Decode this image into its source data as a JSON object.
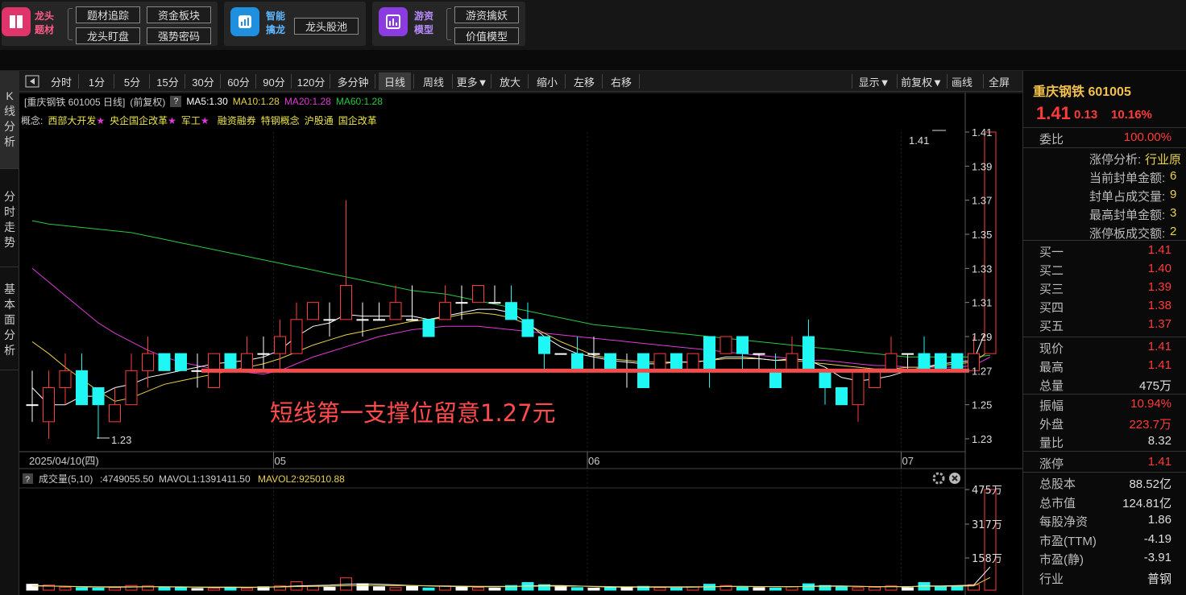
{
  "banner": {
    "groups": [
      {
        "title": "龙头\n题材",
        "buttons": [
          "题材追踪",
          "资金板块",
          "龙头盯盘",
          "强势密码"
        ]
      },
      {
        "title": "智能\n擒龙",
        "buttons": [
          "龙头股池"
        ]
      },
      {
        "title": "游资\n模型",
        "buttons": [
          "游资擒妖",
          "价值模型"
        ]
      }
    ]
  },
  "lefttabs": [
    "K\n线\n分\n析",
    "分\n时\n走\n势",
    "基\n本\n面\n分\n析"
  ],
  "toolbar": {
    "items": [
      "分时",
      "1分",
      "5分",
      "15分",
      "30分",
      "60分",
      "90分",
      "120分",
      "多分钟",
      "日线",
      "周线",
      "更多▼",
      "放大",
      "缩小",
      "左移",
      "右移"
    ],
    "active": "日线",
    "right_items": [
      "显示▼",
      "前复权▼",
      "画线",
      "全屏"
    ]
  },
  "chart": {
    "header": "[重庆钢铁 601005 日线]",
    "adjust": "(前复权)",
    "help": "?",
    "ma": [
      {
        "label": "MA5:1.30",
        "color": "#ffffff"
      },
      {
        "label": "MA10:1.28",
        "color": "#e8d34a"
      },
      {
        "label": "MA20:1.28",
        "color": "#e23ad8"
      },
      {
        "label": "MA60:1.28",
        "color": "#27c93f"
      }
    ],
    "concept_label": "概念:",
    "concepts": [
      "西部大开发",
      "央企国企改革",
      "军工",
      "融资融券",
      "特钢概念",
      "沪股通",
      "国企改革"
    ],
    "concept_star": "★",
    "annotation": "短线第一支撑位留意1.27元",
    "support_level": 1.27,
    "max_label": "1.41",
    "min_label": "1.23",
    "date_label": "2025/04/10(四)",
    "volume_header": "成交量(5,10)",
    "volume_value": ":4749055.50",
    "mavol1": "MAVOL1:1391411.50",
    "mavol2": "MAVOL2:925010.88"
  },
  "chart_data": {
    "type": "candlestick",
    "y_ticks": [
      "1.41",
      "1.39",
      "1.37",
      "1.35",
      "1.33",
      "1.31",
      "1.29",
      "1.27",
      "1.25",
      "1.23"
    ],
    "ylim": [
      1.222,
      1.412
    ],
    "x_ticks": [
      "05",
      "06",
      "07"
    ],
    "x_tick_index": [
      15,
      34,
      53
    ],
    "volume_ticks": [
      "475万",
      "317万",
      "158万"
    ],
    "volume_unit_max": 475,
    "candles": [
      {
        "o": 1.25,
        "c": 1.25,
        "h": 1.27,
        "l": 1.24
      },
      {
        "o": 1.24,
        "c": 1.26,
        "h": 1.27,
        "l": 1.23
      },
      {
        "o": 1.26,
        "c": 1.27,
        "h": 1.28,
        "l": 1.25
      },
      {
        "o": 1.27,
        "c": 1.25,
        "h": 1.28,
        "l": 1.25
      },
      {
        "o": 1.26,
        "c": 1.25,
        "h": 1.26,
        "l": 1.23
      },
      {
        "o": 1.24,
        "c": 1.25,
        "h": 1.26,
        "l": 1.24
      },
      {
        "o": 1.25,
        "c": 1.27,
        "h": 1.28,
        "l": 1.25
      },
      {
        "o": 1.27,
        "c": 1.28,
        "h": 1.29,
        "l": 1.26
      },
      {
        "o": 1.28,
        "c": 1.27,
        "h": 1.28,
        "l": 1.27
      },
      {
        "o": 1.28,
        "c": 1.27,
        "h": 1.28,
        "l": 1.27
      },
      {
        "o": 1.27,
        "c": 1.27,
        "h": 1.28,
        "l": 1.26
      },
      {
        "o": 1.26,
        "c": 1.28,
        "h": 1.28,
        "l": 1.26
      },
      {
        "o": 1.28,
        "c": 1.27,
        "h": 1.28,
        "l": 1.27
      },
      {
        "o": 1.27,
        "c": 1.28,
        "h": 1.29,
        "l": 1.27
      },
      {
        "o": 1.28,
        "c": 1.28,
        "h": 1.29,
        "l": 1.27
      },
      {
        "o": 1.28,
        "c": 1.29,
        "h": 1.3,
        "l": 1.27
      },
      {
        "o": 1.28,
        "c": 1.3,
        "h": 1.31,
        "l": 1.28
      },
      {
        "o": 1.3,
        "c": 1.31,
        "h": 1.31,
        "l": 1.3
      },
      {
        "o": 1.3,
        "c": 1.3,
        "h": 1.31,
        "l": 1.29
      },
      {
        "o": 1.3,
        "c": 1.32,
        "h": 1.37,
        "l": 1.3
      },
      {
        "o": 1.3,
        "c": 1.3,
        "h": 1.31,
        "l": 1.29
      },
      {
        "o": 1.3,
        "c": 1.3,
        "h": 1.31,
        "l": 1.3
      },
      {
        "o": 1.3,
        "c": 1.31,
        "h": 1.32,
        "l": 1.3
      },
      {
        "o": 1.3,
        "c": 1.3,
        "h": 1.32,
        "l": 1.3
      },
      {
        "o": 1.3,
        "c": 1.29,
        "h": 1.3,
        "l": 1.29
      },
      {
        "o": 1.3,
        "c": 1.31,
        "h": 1.32,
        "l": 1.3
      },
      {
        "o": 1.31,
        "c": 1.31,
        "h": 1.32,
        "l": 1.3
      },
      {
        "o": 1.31,
        "c": 1.32,
        "h": 1.32,
        "l": 1.31
      },
      {
        "o": 1.31,
        "c": 1.31,
        "h": 1.32,
        "l": 1.31
      },
      {
        "o": 1.31,
        "c": 1.3,
        "h": 1.32,
        "l": 1.3
      },
      {
        "o": 1.3,
        "c": 1.29,
        "h": 1.31,
        "l": 1.29
      },
      {
        "o": 1.29,
        "c": 1.28,
        "h": 1.29,
        "l": 1.27
      },
      {
        "o": 1.28,
        "c": 1.28,
        "h": 1.28,
        "l": 1.28
      },
      {
        "o": 1.28,
        "c": 1.27,
        "h": 1.29,
        "l": 1.27
      },
      {
        "o": 1.28,
        "c": 1.28,
        "h": 1.29,
        "l": 1.27
      },
      {
        "o": 1.28,
        "c": 1.27,
        "h": 1.28,
        "l": 1.27
      },
      {
        "o": 1.27,
        "c": 1.27,
        "h": 1.28,
        "l": 1.26
      },
      {
        "o": 1.28,
        "c": 1.26,
        "h": 1.28,
        "l": 1.26
      },
      {
        "o": 1.27,
        "c": 1.28,
        "h": 1.28,
        "l": 1.27
      },
      {
        "o": 1.28,
        "c": 1.27,
        "h": 1.28,
        "l": 1.27
      },
      {
        "o": 1.27,
        "c": 1.28,
        "h": 1.28,
        "l": 1.27
      },
      {
        "o": 1.29,
        "c": 1.27,
        "h": 1.29,
        "l": 1.26
      },
      {
        "o": 1.28,
        "c": 1.29,
        "h": 1.29,
        "l": 1.28
      },
      {
        "o": 1.29,
        "c": 1.28,
        "h": 1.29,
        "l": 1.27
      },
      {
        "o": 1.28,
        "c": 1.28,
        "h": 1.28,
        "l": 1.27
      },
      {
        "o": 1.27,
        "c": 1.26,
        "h": 1.28,
        "l": 1.26
      },
      {
        "o": 1.27,
        "c": 1.28,
        "h": 1.29,
        "l": 1.27
      },
      {
        "o": 1.29,
        "c": 1.27,
        "h": 1.3,
        "l": 1.27
      },
      {
        "o": 1.27,
        "c": 1.26,
        "h": 1.27,
        "l": 1.25
      },
      {
        "o": 1.26,
        "c": 1.25,
        "h": 1.26,
        "l": 1.25
      },
      {
        "o": 1.25,
        "c": 1.27,
        "h": 1.27,
        "l": 1.24
      },
      {
        "o": 1.26,
        "c": 1.27,
        "h": 1.27,
        "l": 1.26
      },
      {
        "o": 1.27,
        "c": 1.28,
        "h": 1.29,
        "l": 1.27
      },
      {
        "o": 1.28,
        "c": 1.28,
        "h": 1.28,
        "l": 1.27
      },
      {
        "o": 1.28,
        "c": 1.27,
        "h": 1.29,
        "l": 1.27
      },
      {
        "o": 1.28,
        "c": 1.27,
        "h": 1.28,
        "l": 1.27
      },
      {
        "o": 1.28,
        "c": 1.27,
        "h": 1.28,
        "l": 1.27
      },
      {
        "o": 1.27,
        "c": 1.28,
        "h": 1.29,
        "l": 1.27
      },
      {
        "o": 1.28,
        "c": 1.41,
        "h": 1.41,
        "l": 1.28
      }
    ],
    "ma5": [
      1.26,
      1.25,
      1.25,
      1.255,
      1.255,
      1.26,
      1.262,
      1.266,
      1.268,
      1.27,
      1.272,
      1.274,
      1.275,
      1.276,
      1.278,
      1.282,
      1.29,
      1.296,
      1.298,
      1.303,
      1.302,
      1.302,
      1.302,
      1.302,
      1.3,
      1.302,
      1.304,
      1.306,
      1.306,
      1.304,
      1.298,
      1.29,
      1.284,
      1.28,
      1.278,
      1.276,
      1.275,
      1.274,
      1.274,
      1.275,
      1.275,
      1.276,
      1.278,
      1.278,
      1.277,
      1.276,
      1.277,
      1.276,
      1.272,
      1.266,
      1.264,
      1.265,
      1.267,
      1.27,
      1.272,
      1.274,
      1.275,
      1.276,
      1.3
    ],
    "ma10": [
      1.287,
      1.28,
      1.272,
      1.265,
      1.258,
      1.252,
      1.254,
      1.258,
      1.262,
      1.264,
      1.266,
      1.268,
      1.27,
      1.272,
      1.274,
      1.277,
      1.281,
      1.285,
      1.288,
      1.291,
      1.293,
      1.295,
      1.297,
      1.299,
      1.3,
      1.301,
      1.303,
      1.304,
      1.303,
      1.301,
      1.297,
      1.292,
      1.287,
      1.283,
      1.279,
      1.277,
      1.276,
      1.275,
      1.275,
      1.275,
      1.275,
      1.276,
      1.277,
      1.277,
      1.277,
      1.276,
      1.276,
      1.275,
      1.274,
      1.273,
      1.272,
      1.271,
      1.271,
      1.272,
      1.272,
      1.273,
      1.274,
      1.275,
      1.282
    ],
    "ma20": [
      1.33,
      1.322,
      1.314,
      1.306,
      1.298,
      1.292,
      1.287,
      1.282,
      1.278,
      1.275,
      1.273,
      1.271,
      1.27,
      1.269,
      1.268,
      1.27,
      1.274,
      1.278,
      1.281,
      1.284,
      1.287,
      1.29,
      1.292,
      1.294,
      1.295,
      1.296,
      1.296,
      1.296,
      1.295,
      1.294,
      1.293,
      1.292,
      1.291,
      1.29,
      1.289,
      1.288,
      1.287,
      1.286,
      1.285,
      1.284,
      1.283,
      1.282,
      1.281,
      1.28,
      1.279,
      1.278,
      1.277,
      1.276,
      1.276,
      1.275,
      1.274,
      1.273,
      1.273,
      1.272,
      1.272,
      1.272,
      1.272,
      1.273,
      1.278
    ],
    "ma60": [
      1.358,
      1.356,
      1.355,
      1.354,
      1.353,
      1.352,
      1.351,
      1.349,
      1.347,
      1.345,
      1.343,
      1.341,
      1.339,
      1.337,
      1.335,
      1.333,
      1.331,
      1.329,
      1.327,
      1.325,
      1.323,
      1.321,
      1.319,
      1.317,
      1.316,
      1.315,
      1.313,
      1.311,
      1.309,
      1.307,
      1.305,
      1.303,
      1.301,
      1.299,
      1.297,
      1.296,
      1.295,
      1.294,
      1.293,
      1.292,
      1.291,
      1.29,
      1.289,
      1.288,
      1.287,
      1.286,
      1.285,
      1.284,
      1.283,
      1.282,
      1.281,
      1.28,
      1.279,
      1.278,
      1.278,
      1.278,
      1.278,
      1.278,
      1.279
    ],
    "volume": [
      28,
      24,
      14,
      12,
      10,
      12,
      22,
      20,
      14,
      12,
      8,
      10,
      14,
      10,
      16,
      20,
      40,
      20,
      14,
      58,
      30,
      16,
      12,
      18,
      10,
      20,
      14,
      12,
      10,
      22,
      36,
      26,
      16,
      12,
      10,
      12,
      14,
      18,
      12,
      10,
      16,
      28,
      22,
      14,
      12,
      10,
      16,
      30,
      22,
      16,
      12,
      14,
      20,
      12,
      36,
      16,
      18,
      26,
      475
    ],
    "mavol1": [
      22,
      20,
      18,
      16,
      15,
      14,
      15,
      16,
      16,
      15,
      14,
      13,
      13,
      13,
      14,
      16,
      20,
      22,
      24,
      28,
      30,
      28,
      25,
      22,
      20,
      18,
      17,
      16,
      16,
      17,
      20,
      22,
      22,
      20,
      17,
      15,
      14,
      14,
      14,
      14,
      14,
      16,
      18,
      18,
      17,
      16,
      16,
      18,
      20,
      20,
      18,
      16,
      16,
      16,
      20,
      20,
      22,
      24,
      110
    ],
    "mavol2": [
      20,
      19,
      18,
      17,
      16,
      16,
      16,
      16,
      16,
      16,
      15,
      15,
      15,
      14,
      14,
      15,
      17,
      18,
      19,
      21,
      22,
      22,
      22,
      22,
      21,
      20,
      19,
      18,
      18,
      18,
      18,
      19,
      19,
      19,
      18,
      17,
      16,
      16,
      16,
      16,
      16,
      16,
      17,
      17,
      17,
      17,
      17,
      17,
      18,
      18,
      18,
      17,
      17,
      17,
      18,
      18,
      19,
      20,
      60
    ]
  },
  "colors": {
    "up": "#ff3b3b",
    "down": "#1ef7f3",
    "flat": "#ffffff",
    "support": "#f24c4c",
    "annotation": "#ff4b4b"
  },
  "quote": {
    "name_code": "重庆钢铁 601005",
    "price": "1.41",
    "change": "0.13",
    "pct": "10.16%",
    "rows1": [
      {
        "label": "委比",
        "value": "100.00%",
        "cls": "red"
      }
    ],
    "limit_rows": [
      {
        "label": "涨停分析:",
        "value": "行业原"
      },
      {
        "label": "当前封单金额:",
        "value": "6"
      },
      {
        "label": "封单占成交量:",
        "value": "9"
      },
      {
        "label": "最高封单金额:",
        "value": "3"
      },
      {
        "label": "涨停板成交额:",
        "value": "2"
      }
    ],
    "bids": [
      {
        "label": "买一",
        "value": "1.41"
      },
      {
        "label": "买二",
        "value": "1.40"
      },
      {
        "label": "买三",
        "value": "1.39"
      },
      {
        "label": "买四",
        "value": "1.38"
      },
      {
        "label": "买五",
        "value": "1.37"
      }
    ],
    "stats": [
      {
        "label": "现价",
        "value": "1.41",
        "cls": "red"
      },
      {
        "label": "最高",
        "value": "1.41",
        "cls": "red"
      },
      {
        "label": "总量",
        "value": "475万",
        "cls": "white"
      }
    ],
    "stats2": [
      {
        "label": "振幅",
        "value": "10.94%",
        "cls": "red"
      },
      {
        "label": "外盘",
        "value": "223.7万",
        "cls": "red"
      },
      {
        "label": "量比",
        "value": "8.32",
        "cls": "white"
      }
    ],
    "stats3": [
      {
        "label": "涨停",
        "value": "1.41",
        "cls": "red"
      }
    ],
    "fundamentals": [
      {
        "label": "总股本",
        "value": "88.52亿"
      },
      {
        "label": "总市值",
        "value": "124.81亿"
      },
      {
        "label": "每股净资",
        "value": "1.86"
      },
      {
        "label": "市盈(TTM)",
        "value": "-4.19"
      },
      {
        "label": "市盈(静)",
        "value": "-3.91"
      },
      {
        "label": "行业",
        "value": "普钢"
      }
    ]
  }
}
